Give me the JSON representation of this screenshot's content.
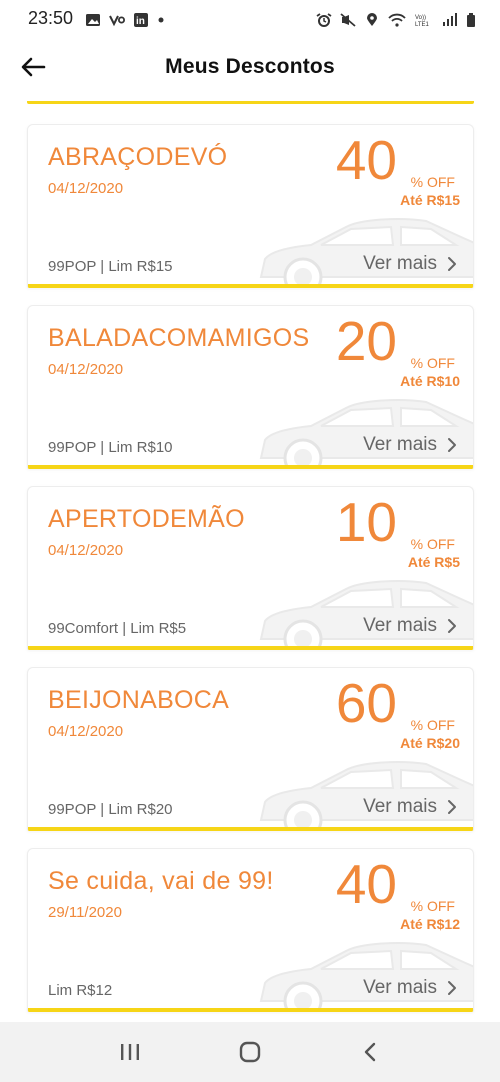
{
  "status_bar": {
    "time": "23:50",
    "left_icons": [
      "image-icon",
      "vivo-icon",
      "linkedin-icon",
      "dot-icon"
    ],
    "right_icons": [
      "alarm-icon",
      "mute-icon",
      "location-icon",
      "wifi-icon",
      "volte-icon",
      "signal-icon",
      "battery-icon"
    ],
    "linkedin_text": "in",
    "volte_text": "Vo)) LTE1"
  },
  "header": {
    "title": "Meus Descontos",
    "back_icon": "arrow-left-icon"
  },
  "colors": {
    "accent": "#f0883a",
    "stripe": "#f6d517",
    "muted_text": "#666666"
  },
  "coupons": [
    {
      "code": "ABRAÇODEVÓ",
      "date": "04/12/2020",
      "percent": "40",
      "off_label": "% OFF",
      "cap": "Até R$15",
      "conditions": "99POP | Lim R$15",
      "see_more": "Ver mais"
    },
    {
      "code": "BALADACOMAMIGOS",
      "date": "04/12/2020",
      "percent": "20",
      "off_label": "% OFF",
      "cap": "Até R$10",
      "conditions": "99POP | Lim R$10",
      "see_more": "Ver mais"
    },
    {
      "code": "APERTODEMÃO",
      "date": "04/12/2020",
      "percent": "10",
      "off_label": "% OFF",
      "cap": "Até R$5",
      "conditions": "99Comfort | Lim R$5",
      "see_more": "Ver mais"
    },
    {
      "code": "BEIJONABOCA",
      "date": "04/12/2020",
      "percent": "60",
      "off_label": "% OFF",
      "cap": "Até R$20",
      "conditions": "99POP | Lim R$20",
      "see_more": "Ver mais"
    },
    {
      "code": "Se cuida, vai de 99!",
      "date": "29/11/2020",
      "percent": "40",
      "off_label": "% OFF",
      "cap": "Até R$12",
      "conditions": "Lim R$12",
      "see_more": "Ver mais"
    }
  ],
  "nav_bar": {
    "items": [
      "recent-apps-icon",
      "home-icon",
      "back-icon"
    ]
  }
}
